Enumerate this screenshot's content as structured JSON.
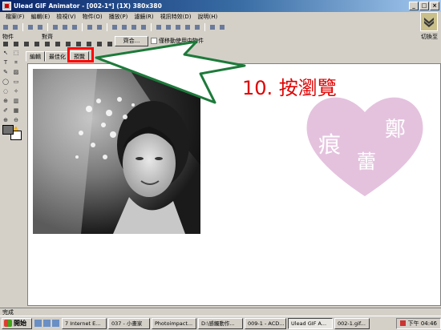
{
  "window": {
    "title": "Ulead GIF Animator - [002-1*] (1X) 380x380",
    "min": "_",
    "max": "□",
    "close": "×"
  },
  "menu": [
    "檔案(F)",
    "編輯(E)",
    "檢視(V)",
    "物件(O)",
    "播放(P)",
    "濾鏡(R)",
    "視訊特效(D)",
    "說明(H)"
  ],
  "menu_right": "切換至",
  "toolbar_groups": {
    "left_label": "物件",
    "right_label": "對齊"
  },
  "preset_button": "齊合...",
  "checkbox_label": "僅移動使用中物件",
  "tabs": [
    "編輯",
    "最佳化",
    "預覽"
  ],
  "active_tab": "預覽",
  "annotation": "10. 按瀏覽",
  "watermark": {
    "chars": [
      "痕",
      "鄭",
      "蕾"
    ],
    "color": "#d9a8d0"
  },
  "status": "完成",
  "taskbar": {
    "start": "開始",
    "tasks": [
      "7 Internet E...",
      "037 - 小畫家",
      "Photoimpact...",
      "D:\\感觸動作...",
      "009-1 - ACD...",
      "Ulead GIF A...",
      "002-1.gif..."
    ],
    "active_task": "Ulead GIF A...",
    "clock": "下午 04:46"
  }
}
